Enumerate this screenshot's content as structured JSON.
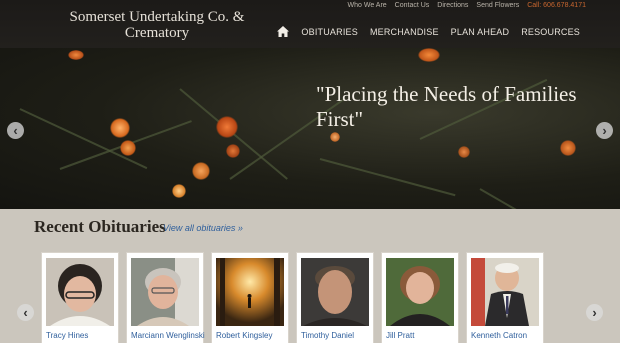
{
  "header": {
    "brand_line1": "Somerset Undertaking Co. &",
    "brand_line2": "Crematory",
    "top_links": [
      "Who We Are",
      "Contact Us",
      "Directions",
      "Send Flowers"
    ],
    "phone": "Call: 606.678.4171",
    "nav": [
      "OBITUARIES",
      "MERCHANDISE",
      "PLAN AHEAD",
      "RESOURCES"
    ]
  },
  "hero": {
    "tagline": "\"Placing the Needs of Families First\""
  },
  "obituaries": {
    "title": "Recent Obituaries",
    "view_all": "View all obituaries »",
    "people": [
      "Tracy Hines",
      "Marciann Wenglinski",
      "Robert Kingsley",
      "Timothy Daniel",
      "Jill Pratt",
      "Kenneth Catron"
    ]
  },
  "colors": {
    "accent_link": "#2f5f9c",
    "phone": "#c9662f",
    "header_bg": "#1c1a18"
  }
}
